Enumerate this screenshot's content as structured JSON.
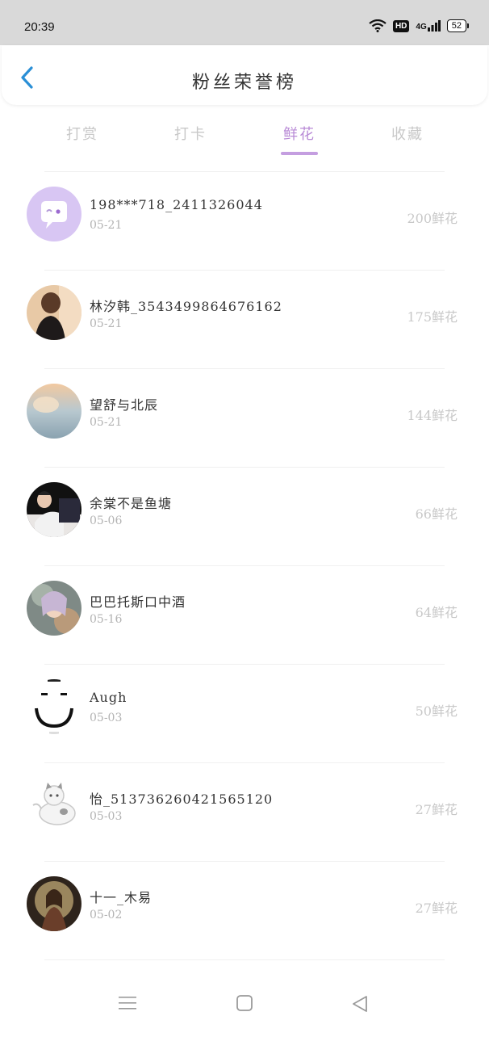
{
  "status": {
    "time": "20:39",
    "hd": "HD",
    "network": "4G",
    "battery": "52"
  },
  "header": {
    "title": "粉丝荣誉榜"
  },
  "tabs": [
    {
      "label": "打赏"
    },
    {
      "label": "打卡"
    },
    {
      "label": "鲜花",
      "active": true
    },
    {
      "label": "收藏"
    }
  ],
  "rows": [
    {
      "name": "198***718_2411326044",
      "date": "05-21",
      "count": "200鲜花",
      "avatar": "default-chat-avatar"
    },
    {
      "name": "林汐韩_3543499864676162",
      "date": "05-21",
      "count": "175鲜花",
      "avatar": "photo-avatar"
    },
    {
      "name": "望舒与北辰",
      "date": "05-21",
      "count": "144鲜花",
      "avatar": "photo-avatar"
    },
    {
      "name": "余棠不是鱼塘",
      "date": "05-06",
      "count": "66鲜花",
      "avatar": "photo-avatar"
    },
    {
      "name": "巴巴托斯口中酒",
      "date": "05-16",
      "count": "64鲜花",
      "avatar": "photo-avatar"
    },
    {
      "name": "Augh",
      "date": "05-03",
      "count": "50鲜花",
      "avatar": "smiley-avatar"
    },
    {
      "name": "怡_513736260421565120",
      "date": "05-03",
      "count": "27鲜花",
      "avatar": "cat-avatar"
    },
    {
      "name": "十一_木易",
      "date": "05-02",
      "count": "27鲜花",
      "avatar": "photo-avatar"
    }
  ],
  "colors": {
    "accent": "#b88ad6",
    "avatar_default": "#d8c6f3"
  }
}
